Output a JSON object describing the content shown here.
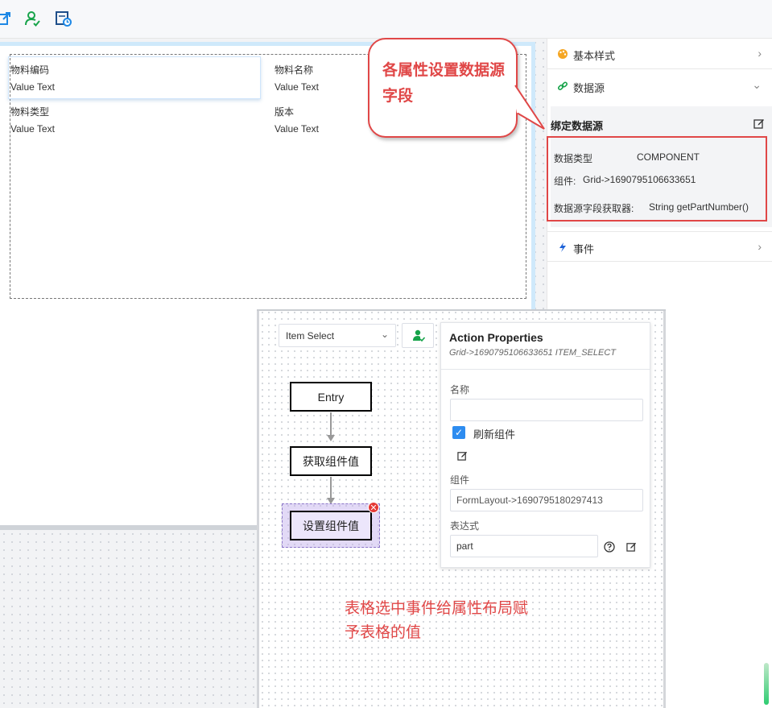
{
  "toolbar": {
    "icons": [
      "share-icon",
      "user-check-icon",
      "calendar-clock-icon"
    ]
  },
  "form": {
    "fields": [
      {
        "label": "物料编码",
        "value": "Value Text"
      },
      {
        "label": "物料名称",
        "value": "Value Text"
      },
      {
        "label": "物料类型",
        "value": "Value Text"
      },
      {
        "label": "版本",
        "value": "Value Text"
      }
    ]
  },
  "right_panel": {
    "sections": {
      "basic_style": "基本样式",
      "datasource": "数据源",
      "events": "事件"
    },
    "bind_title": "绑定数据源",
    "bind": {
      "type_label": "数据类型",
      "type_value": "COMPONENT",
      "component_label": "组件:",
      "component_value": "Grid->1690795106633651",
      "getter_label": "数据源字段获取器:",
      "getter_value": "String getPartNumber()"
    }
  },
  "callout": {
    "text": "各属性设置数据源字段"
  },
  "flow": {
    "event_select": "Item Select",
    "nodes": {
      "entry": "Entry",
      "get_value": "获取组件值",
      "set_value": "设置组件值"
    }
  },
  "action_properties": {
    "title": "Action Properties",
    "subtitle": "Grid->1690795106633651 ITEM_SELECT",
    "name_label": "名称",
    "name_value": "",
    "refresh_label": "刷新组件",
    "refresh_checked": true,
    "component_label": "组件",
    "component_value": "FormLayout->1690795180297413",
    "expression_label": "表达式",
    "expression_value": "part"
  },
  "annotation": {
    "line1": "表格选中事件给属性布局赋",
    "line2": "予表格的值"
  },
  "colors": {
    "accent_red": "#e04747",
    "primary_blue": "#2d8cf0",
    "icon_green": "#17a34a",
    "selection_purple": "#8a74c8"
  }
}
